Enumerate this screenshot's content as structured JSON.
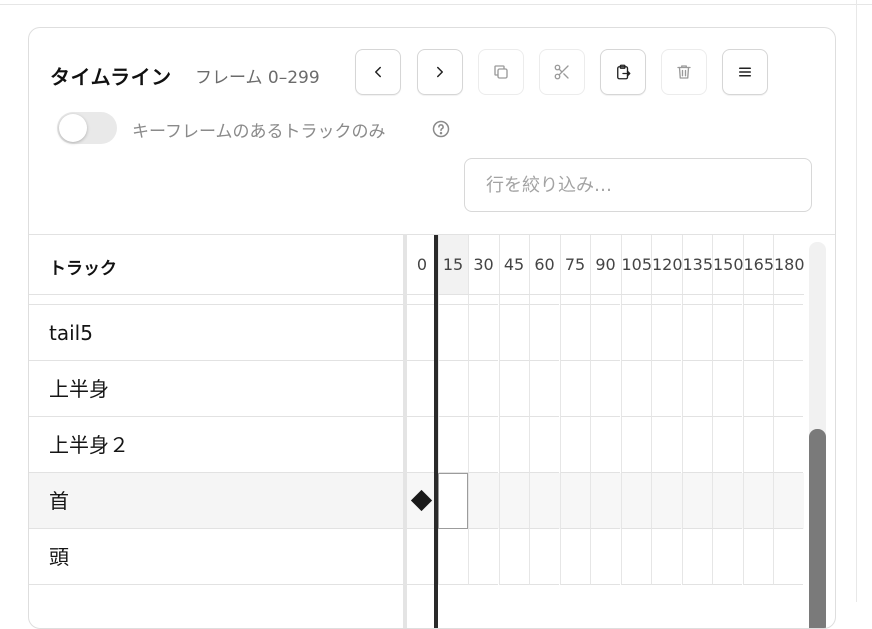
{
  "panel": {
    "title": "タイムライン",
    "frame_range": "フレーム 0–299"
  },
  "toolbar": {
    "buttons": [
      {
        "icon": "chevron-left-icon",
        "enabled": true
      },
      {
        "icon": "chevron-right-icon",
        "enabled": true
      },
      {
        "icon": "copy-icon",
        "enabled": false
      },
      {
        "icon": "scissors-icon",
        "enabled": false
      },
      {
        "icon": "paste-icon",
        "enabled": true
      },
      {
        "icon": "trash-icon",
        "enabled": false
      },
      {
        "icon": "menu-icon",
        "enabled": true
      }
    ]
  },
  "filter_toggle": {
    "label": "キーフレームのあるトラックのみ",
    "on": false
  },
  "filter_input": {
    "placeholder": "行を絞り込み…",
    "value": ""
  },
  "track_header": "トラック",
  "ruler": {
    "ticks": [
      "0",
      "15",
      "30",
      "45",
      "60",
      "75",
      "90",
      "105",
      "120",
      "135",
      "150",
      "165",
      "180"
    ],
    "current_frame": "15"
  },
  "tracks": [
    {
      "label": "tail5",
      "selected": false,
      "keyframe": false
    },
    {
      "label": "上半身",
      "selected": false,
      "keyframe": false
    },
    {
      "label": "上半身２",
      "selected": false,
      "keyframe": false
    },
    {
      "label": "首",
      "selected": true,
      "keyframe": true
    },
    {
      "label": "頭",
      "selected": false,
      "keyframe": false
    }
  ],
  "colors": {
    "playhead": "#2a2a2a",
    "keyframe": "#1a1a1a",
    "scroll_thumb": "#7a7a7a"
  }
}
